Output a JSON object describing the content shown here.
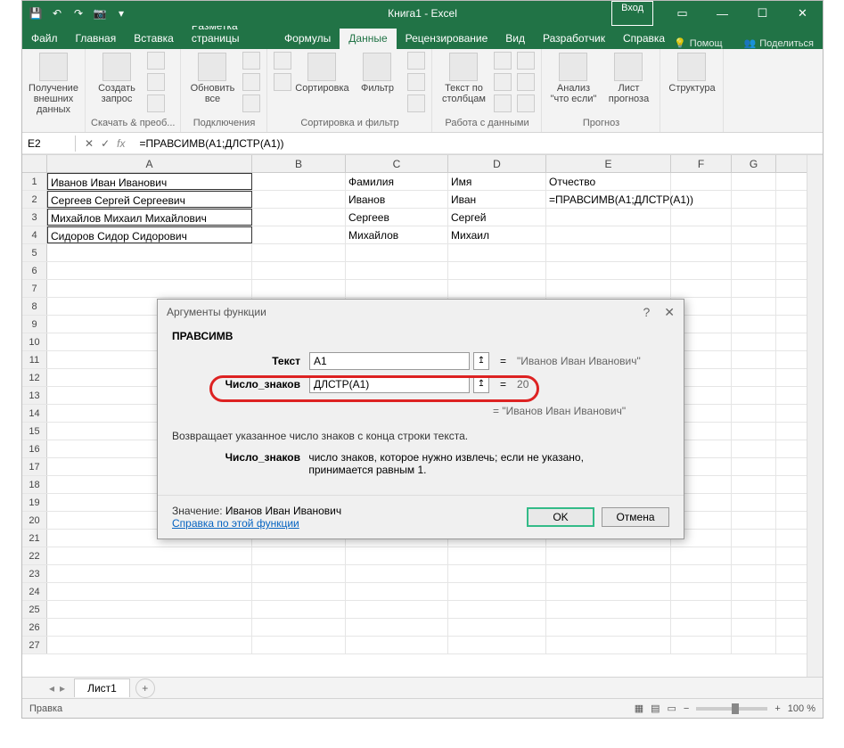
{
  "app": {
    "title": "Книга1 - Excel",
    "login": "Вход"
  },
  "tabs": {
    "file": "Файл",
    "home": "Главная",
    "insert": "Вставка",
    "layout": "Разметка страницы",
    "formulas": "Формулы",
    "data": "Данные",
    "review": "Рецензирование",
    "view": "Вид",
    "developer": "Разработчик",
    "help": "Справка",
    "tell": "Помощ",
    "share": "Поделиться"
  },
  "ribbon": {
    "g1": {
      "btn": "Получение внешних данных",
      "label": ""
    },
    "g2": {
      "btn": "Создать запрос",
      "label": "Скачать & преоб..."
    },
    "g3": {
      "btn": "Обновить все",
      "label": "Подключения"
    },
    "g4": {
      "btn": "Сортировка",
      "btn2": "Фильтр",
      "label": "Сортировка и фильтр"
    },
    "g5": {
      "btn": "Текст по столбцам",
      "label": "Работа с данными"
    },
    "g6": {
      "btn": "Анализ \"что если\"",
      "btn2": "Лист прогноза",
      "label": "Прогноз"
    },
    "g7": {
      "btn": "Структура"
    }
  },
  "namebox": "E2",
  "formula": "=ПРАВСИМВ(A1;ДЛСТР(A1))",
  "cols": [
    "A",
    "B",
    "C",
    "D",
    "E",
    "F",
    "G"
  ],
  "cells": {
    "r1": {
      "A": "Иванов Иван Иванович",
      "C": "Фамилия",
      "D": "Имя",
      "E": "Отчество"
    },
    "r2": {
      "A": "Сергеев Сергей Сергеевич",
      "C": "Иванов",
      "D": "Иван",
      "E": "=ПРАВСИМВ(A1;ДЛСТР(A1))"
    },
    "r3": {
      "A": "Михайлов Михаил Михайлович",
      "C": "Сергеев",
      "D": "Сергей"
    },
    "r4": {
      "A": "Сидоров Сидор Сидорович",
      "C": "Михайлов",
      "D": "Михаил"
    }
  },
  "dialog": {
    "title": "Аргументы функции",
    "fname": "ПРАВСИМВ",
    "arg1": {
      "label": "Текст",
      "value": "A1",
      "result": "\"Иванов Иван Иванович\""
    },
    "arg2": {
      "label": "Число_знаков",
      "value": "ДЛСТР(A1)",
      "result": "20"
    },
    "preview": "= \"Иванов Иван Иванович\"",
    "desc": "Возвращает указанное число знаков с конца строки текста.",
    "arg_desc_label": "Число_знаков",
    "arg_desc": "число знаков, которое нужно извлечь; если не указано, принимается равным 1.",
    "value_label": "Значение:",
    "value": "Иванов Иван Иванович",
    "help": "Справка по этой функции",
    "ok": "OK",
    "cancel": "Отмена"
  },
  "sheet": {
    "tab1": "Лист1"
  },
  "status": {
    "mode": "Правка",
    "zoom": "100 %"
  }
}
